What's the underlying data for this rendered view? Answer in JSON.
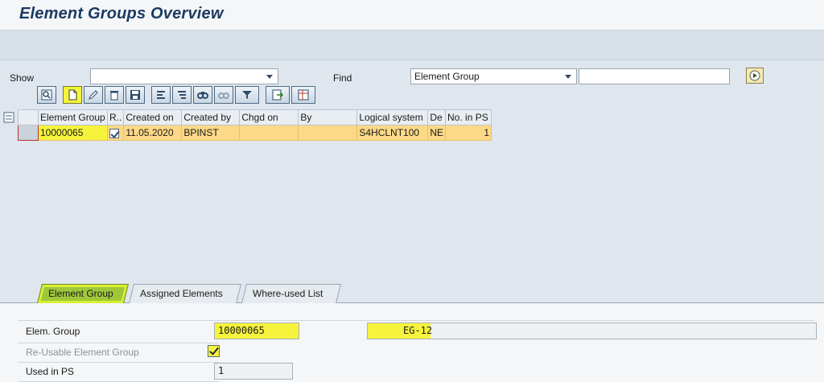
{
  "title": "Element Groups Overview",
  "filter": {
    "show_label": "Show",
    "show_value": "",
    "find_label": "Find",
    "find_value": "Element Group",
    "find_text": ""
  },
  "toolbar": {
    "icons": [
      "details-icon",
      "create-icon",
      "change-icon",
      "delete-icon",
      "save-icon",
      "sort-ascending-icon",
      "sort-descending-icon",
      "find-icon",
      "find-next-icon",
      "filter-icon",
      "export-icon",
      "layout-icon"
    ]
  },
  "grid": {
    "columns": [
      "Element Group",
      "R..",
      "Created on",
      "Created by",
      "Chgd on",
      "By",
      "Logical system",
      "De",
      "No. in PS"
    ],
    "rows": [
      {
        "element_group": "10000065",
        "reusable": true,
        "created_on": "11.05.2020",
        "created_by": "BPINST",
        "chgd_on": "",
        "by": "",
        "logical_system": "S4HCLNT100",
        "de": "NE",
        "no_in_ps": "1"
      }
    ]
  },
  "tabs": [
    {
      "label": "Element Group",
      "active": true
    },
    {
      "label": "Assigned Elements",
      "active": false
    },
    {
      "label": "Where-used List",
      "active": false
    }
  ],
  "detail": {
    "elem_group_label": "Elem. Group",
    "elem_group_value": "10000065",
    "elem_group_desc": "EG-12",
    "reusable_label": "Re-Usable Element Group",
    "reusable_checked": true,
    "used_in_ps_label": "Used in PS",
    "used_in_ps_value": "1"
  },
  "colors": {
    "highlight": "#f6f33c",
    "row_selected": "#fcd986",
    "title": "#1d3a61"
  }
}
